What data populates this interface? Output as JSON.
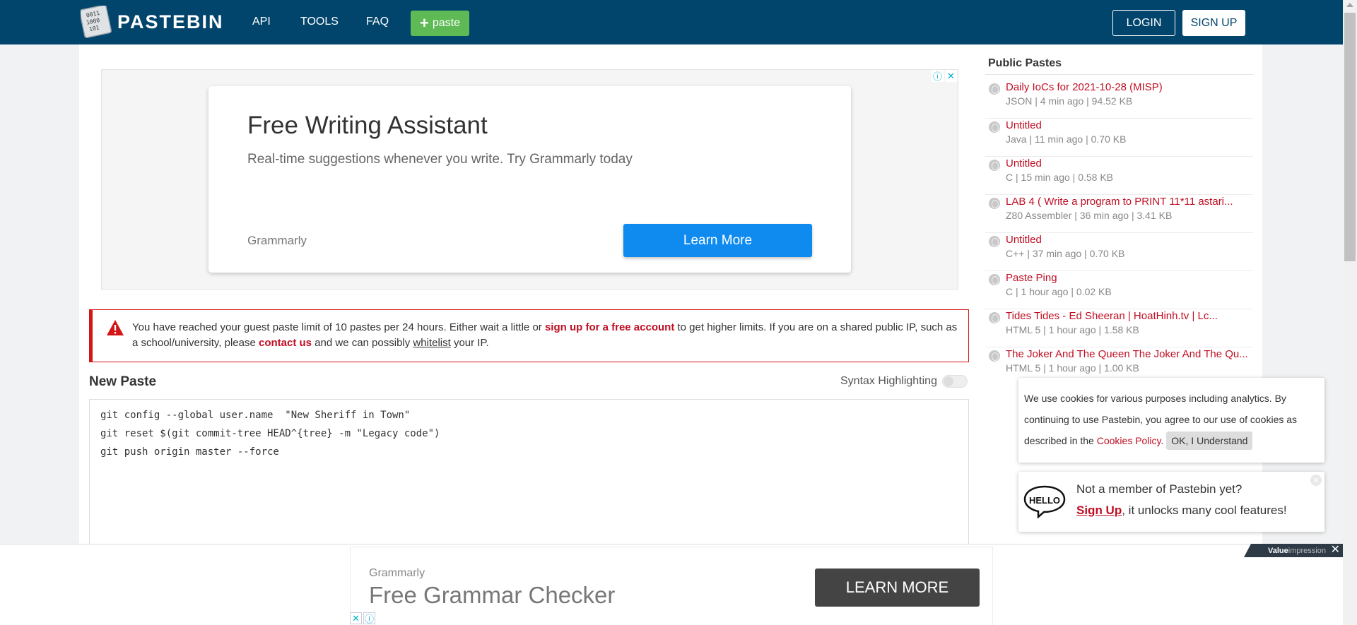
{
  "header": {
    "logo_text": "PASTEBIN",
    "nav": [
      "API",
      "TOOLS",
      "FAQ"
    ],
    "paste_label": "paste",
    "login_label": "LOGIN",
    "signup_label": "SIGN UP"
  },
  "ad_top": {
    "title": "Free Writing Assistant",
    "subtitle": "Real-time suggestions whenever you write. Try Grammarly today",
    "brand": "Grammarly",
    "button": "Learn More"
  },
  "warning": {
    "t1": "You have reached your guest paste limit of 10 pastes per 24 hours. Either wait a little or ",
    "link1": "sign up for a free account",
    "t2": " to get higher limits. If you are on a shared public IP, such as a school/university, please ",
    "link2": "contact us",
    "t3": " and we can possibly ",
    "link3": "whitelist",
    "t4": " your IP."
  },
  "new_paste": {
    "title": "New Paste",
    "syntax_label": "Syntax Highlighting",
    "code_lines": [
      "git config --global user.name  \"New Sheriff in Town\"",
      "git reset $(git commit-tree HEAD^{tree} -m \"Legacy code\")",
      "git push origin master --force"
    ]
  },
  "sidebar": {
    "title": "Public Pastes",
    "items": [
      {
        "title": "Daily IoCs for 2021-10-28 (MISP)",
        "meta": "JSON | 4 min ago | 94.52 KB"
      },
      {
        "title": "Untitled",
        "meta": "Java | 11 min ago | 0.70 KB"
      },
      {
        "title": "Untitled",
        "meta": "C | 15 min ago | 0.58 KB"
      },
      {
        "title": "LAB 4 ( Write a program to PRINT 11*11 astari...",
        "meta": "Z80 Assembler | 36 min ago | 3.41 KB"
      },
      {
        "title": "Untitled",
        "meta": "C++ | 37 min ago | 0.70 KB"
      },
      {
        "title": "Paste Ping",
        "meta": "C | 1 hour ago | 0.02 KB"
      },
      {
        "title": "Tides Tides - Ed Sheeran | HoatHinh.tv | Lc...",
        "meta": "HTML 5 | 1 hour ago | 1.58 KB"
      },
      {
        "title": "The Joker And The Queen The Joker And The Qu...",
        "meta": "HTML 5 | 1 hour ago | 1.00 KB"
      }
    ]
  },
  "cookie": {
    "text": "We use cookies for various purposes including analytics. By continuing to use Pastebin, you agree to our use of cookies as described in the ",
    "link": "Cookies Policy",
    "after": ". ",
    "ok": "OK, I Understand"
  },
  "member": {
    "hello": "HELLO",
    "question": "Not a member of Pastebin yet?",
    "signup": "Sign Up",
    "rest": ", it unlocks many cool features!"
  },
  "bottom_ad": {
    "brand": "Grammarly",
    "title": "Free Grammar Checker",
    "button": "LEARN MORE",
    "badge_bold": "Value",
    "badge_light": "impression"
  },
  "colors": {
    "header_bg": "#02456c",
    "accent_red": "#c00e23",
    "paste_green": "#5eba55",
    "ad_blue": "#0f8bf0"
  }
}
